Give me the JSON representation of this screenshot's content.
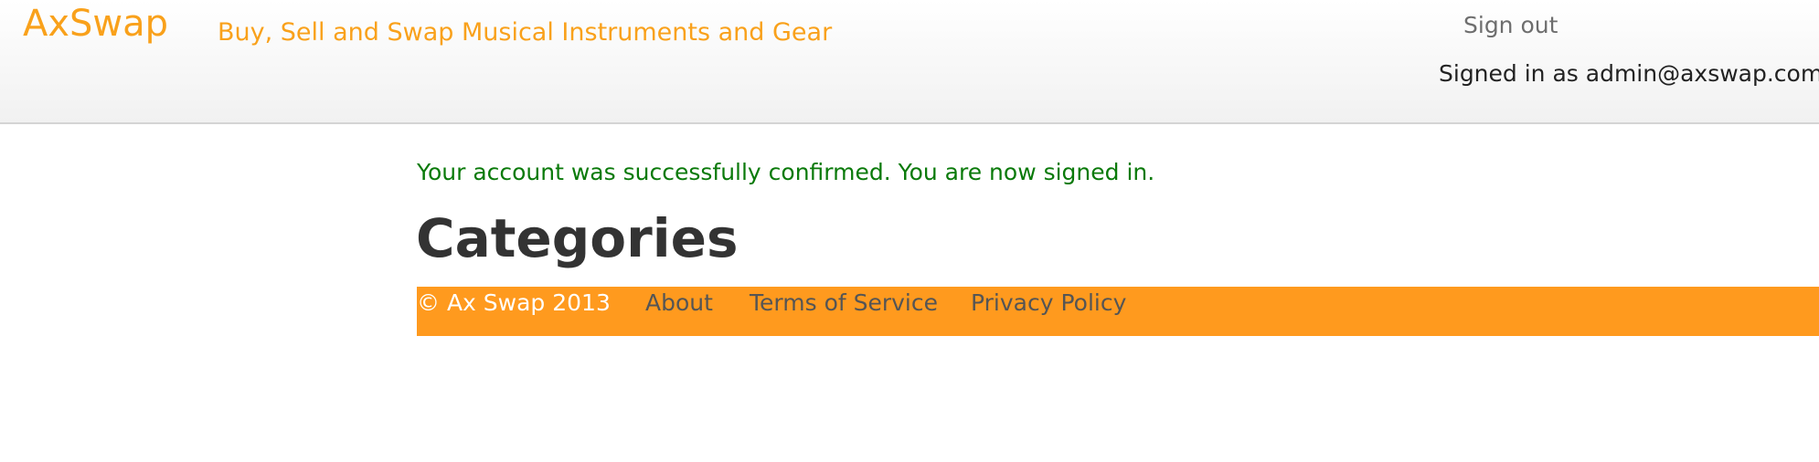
{
  "header": {
    "brand": "AxSwap",
    "tagline": "Buy, Sell and Swap Musical Instruments and Gear",
    "sign_out": "Sign out",
    "signed_in_as": "Signed in as admin@axswap.com"
  },
  "flash": {
    "message": "Your account was successfully confirmed. You are now signed in."
  },
  "main": {
    "title": "Categories"
  },
  "footer": {
    "copyright": "© Ax Swap 2013",
    "links": [
      "About",
      "Terms of Service",
      "Privacy Policy"
    ]
  },
  "colors": {
    "brand": "#f9a11b",
    "footer_background": "#ff9a1e",
    "flash_text": "#0a7a0a",
    "heading": "#333333"
  }
}
